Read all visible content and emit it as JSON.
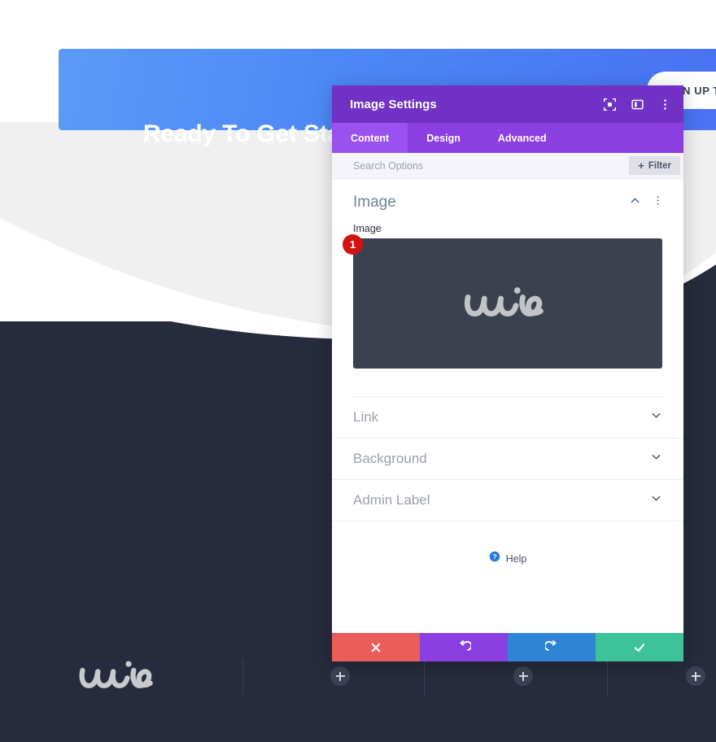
{
  "background_page": {
    "cta": {
      "heading": "Ready To Get Started?",
      "signup_button_label": "N UP T",
      "signup_button_full_label": "SIGN UP TODAY"
    },
    "footer": {
      "logo_text": "wire",
      "add_button_label": "+"
    },
    "colors": {
      "cta_blue": "#4b86f5",
      "page_gray": "#f0f0f0",
      "dark_navy": "#262b3d"
    }
  },
  "modal": {
    "title": "Image Settings",
    "header_icons": [
      {
        "name": "focus-icon",
        "label": "Focus"
      },
      {
        "name": "layout-icon",
        "label": "Layout"
      },
      {
        "name": "more-vertical-icon",
        "label": "More"
      }
    ],
    "tabs": [
      {
        "label": "Content",
        "active": true
      },
      {
        "label": "Design",
        "active": false
      },
      {
        "label": "Advanced",
        "active": false
      }
    ],
    "search": {
      "value": "",
      "placeholder": "Search Options"
    },
    "filter_button": {
      "plus": "+",
      "label": "Filter"
    },
    "section": {
      "title": "Image",
      "collapse_icon": "chevron-up-icon",
      "more_icon": "more-vertical-icon",
      "field_label": "Image",
      "badge_count": "1",
      "preview_logo_text": "wire"
    },
    "accordions": [
      {
        "label": "Link"
      },
      {
        "label": "Background"
      },
      {
        "label": "Admin Label"
      }
    ],
    "help": {
      "label": "Help",
      "icon": "question-circle-icon"
    },
    "footer_actions": [
      {
        "name": "cancel-button",
        "icon": "close-icon",
        "color": "#eb5d58"
      },
      {
        "name": "undo-button",
        "icon": "undo-icon",
        "color": "#8b3fe0"
      },
      {
        "name": "redo-button",
        "icon": "redo-icon",
        "color": "#2f84d6"
      },
      {
        "name": "save-button",
        "icon": "check-icon",
        "color": "#3dc29a"
      }
    ],
    "colors": {
      "header_purple": "#7031c4",
      "tabbar_purple": "#8b3fe0",
      "active_tab_purple": "#9a52ee",
      "badge_red": "#d31111"
    }
  }
}
